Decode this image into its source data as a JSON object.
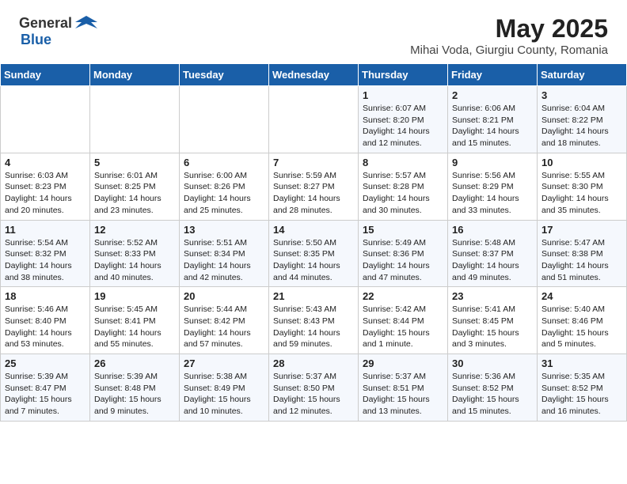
{
  "header": {
    "logo_general": "General",
    "logo_blue": "Blue",
    "month_year": "May 2025",
    "location": "Mihai Voda, Giurgiu County, Romania"
  },
  "weekdays": [
    "Sunday",
    "Monday",
    "Tuesday",
    "Wednesday",
    "Thursday",
    "Friday",
    "Saturday"
  ],
  "weeks": [
    [
      {
        "day": "",
        "text": ""
      },
      {
        "day": "",
        "text": ""
      },
      {
        "day": "",
        "text": ""
      },
      {
        "day": "",
        "text": ""
      },
      {
        "day": "1",
        "text": "Sunrise: 6:07 AM\nSunset: 8:20 PM\nDaylight: 14 hours\nand 12 minutes."
      },
      {
        "day": "2",
        "text": "Sunrise: 6:06 AM\nSunset: 8:21 PM\nDaylight: 14 hours\nand 15 minutes."
      },
      {
        "day": "3",
        "text": "Sunrise: 6:04 AM\nSunset: 8:22 PM\nDaylight: 14 hours\nand 18 minutes."
      }
    ],
    [
      {
        "day": "4",
        "text": "Sunrise: 6:03 AM\nSunset: 8:23 PM\nDaylight: 14 hours\nand 20 minutes."
      },
      {
        "day": "5",
        "text": "Sunrise: 6:01 AM\nSunset: 8:25 PM\nDaylight: 14 hours\nand 23 minutes."
      },
      {
        "day": "6",
        "text": "Sunrise: 6:00 AM\nSunset: 8:26 PM\nDaylight: 14 hours\nand 25 minutes."
      },
      {
        "day": "7",
        "text": "Sunrise: 5:59 AM\nSunset: 8:27 PM\nDaylight: 14 hours\nand 28 minutes."
      },
      {
        "day": "8",
        "text": "Sunrise: 5:57 AM\nSunset: 8:28 PM\nDaylight: 14 hours\nand 30 minutes."
      },
      {
        "day": "9",
        "text": "Sunrise: 5:56 AM\nSunset: 8:29 PM\nDaylight: 14 hours\nand 33 minutes."
      },
      {
        "day": "10",
        "text": "Sunrise: 5:55 AM\nSunset: 8:30 PM\nDaylight: 14 hours\nand 35 minutes."
      }
    ],
    [
      {
        "day": "11",
        "text": "Sunrise: 5:54 AM\nSunset: 8:32 PM\nDaylight: 14 hours\nand 38 minutes."
      },
      {
        "day": "12",
        "text": "Sunrise: 5:52 AM\nSunset: 8:33 PM\nDaylight: 14 hours\nand 40 minutes."
      },
      {
        "day": "13",
        "text": "Sunrise: 5:51 AM\nSunset: 8:34 PM\nDaylight: 14 hours\nand 42 minutes."
      },
      {
        "day": "14",
        "text": "Sunrise: 5:50 AM\nSunset: 8:35 PM\nDaylight: 14 hours\nand 44 minutes."
      },
      {
        "day": "15",
        "text": "Sunrise: 5:49 AM\nSunset: 8:36 PM\nDaylight: 14 hours\nand 47 minutes."
      },
      {
        "day": "16",
        "text": "Sunrise: 5:48 AM\nSunset: 8:37 PM\nDaylight: 14 hours\nand 49 minutes."
      },
      {
        "day": "17",
        "text": "Sunrise: 5:47 AM\nSunset: 8:38 PM\nDaylight: 14 hours\nand 51 minutes."
      }
    ],
    [
      {
        "day": "18",
        "text": "Sunrise: 5:46 AM\nSunset: 8:40 PM\nDaylight: 14 hours\nand 53 minutes."
      },
      {
        "day": "19",
        "text": "Sunrise: 5:45 AM\nSunset: 8:41 PM\nDaylight: 14 hours\nand 55 minutes."
      },
      {
        "day": "20",
        "text": "Sunrise: 5:44 AM\nSunset: 8:42 PM\nDaylight: 14 hours\nand 57 minutes."
      },
      {
        "day": "21",
        "text": "Sunrise: 5:43 AM\nSunset: 8:43 PM\nDaylight: 14 hours\nand 59 minutes."
      },
      {
        "day": "22",
        "text": "Sunrise: 5:42 AM\nSunset: 8:44 PM\nDaylight: 15 hours\nand 1 minute."
      },
      {
        "day": "23",
        "text": "Sunrise: 5:41 AM\nSunset: 8:45 PM\nDaylight: 15 hours\nand 3 minutes."
      },
      {
        "day": "24",
        "text": "Sunrise: 5:40 AM\nSunset: 8:46 PM\nDaylight: 15 hours\nand 5 minutes."
      }
    ],
    [
      {
        "day": "25",
        "text": "Sunrise: 5:39 AM\nSunset: 8:47 PM\nDaylight: 15 hours\nand 7 minutes."
      },
      {
        "day": "26",
        "text": "Sunrise: 5:39 AM\nSunset: 8:48 PM\nDaylight: 15 hours\nand 9 minutes."
      },
      {
        "day": "27",
        "text": "Sunrise: 5:38 AM\nSunset: 8:49 PM\nDaylight: 15 hours\nand 10 minutes."
      },
      {
        "day": "28",
        "text": "Sunrise: 5:37 AM\nSunset: 8:50 PM\nDaylight: 15 hours\nand 12 minutes."
      },
      {
        "day": "29",
        "text": "Sunrise: 5:37 AM\nSunset: 8:51 PM\nDaylight: 15 hours\nand 13 minutes."
      },
      {
        "day": "30",
        "text": "Sunrise: 5:36 AM\nSunset: 8:52 PM\nDaylight: 15 hours\nand 15 minutes."
      },
      {
        "day": "31",
        "text": "Sunrise: 5:35 AM\nSunset: 8:52 PM\nDaylight: 15 hours\nand 16 minutes."
      }
    ]
  ]
}
